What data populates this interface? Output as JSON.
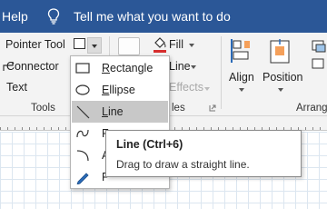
{
  "titlebar": {
    "help": "Help",
    "tell_me": "Tell me what you want to do",
    "bg_color": "#2b5797"
  },
  "ribbon": {
    "tools_group": {
      "pointer_tool": "Pointer Tool",
      "connector": "Connector",
      "text": "Text",
      "label": "Tools"
    },
    "shape_styles": {
      "fill": "Fill",
      "line": "Line",
      "effects": "Effects",
      "label": "Shape Styles",
      "visible_label": "les"
    },
    "arrange_group": {
      "align": "Align",
      "position": "Position",
      "label": "Arrange",
      "visible_label": "Arrang"
    }
  },
  "shapes_menu": {
    "items": [
      {
        "label": "Rectangle",
        "icon": "rectangle-icon",
        "hotkey": "R"
      },
      {
        "label": "Ellipse",
        "icon": "ellipse-icon",
        "hotkey": "E"
      },
      {
        "label": "Line",
        "icon": "line-icon",
        "hotkey": "L",
        "highlighted": true
      },
      {
        "label": "Freeform",
        "icon": "freeform-icon",
        "visible": "F"
      },
      {
        "label": "Arc",
        "icon": "arc-icon",
        "visible": "A"
      },
      {
        "label": "Pencil",
        "icon": "pencil-icon",
        "visible": "P"
      }
    ]
  },
  "tooltip": {
    "title": "Line (Ctrl+6)",
    "description": "Drag to draw a straight line."
  }
}
